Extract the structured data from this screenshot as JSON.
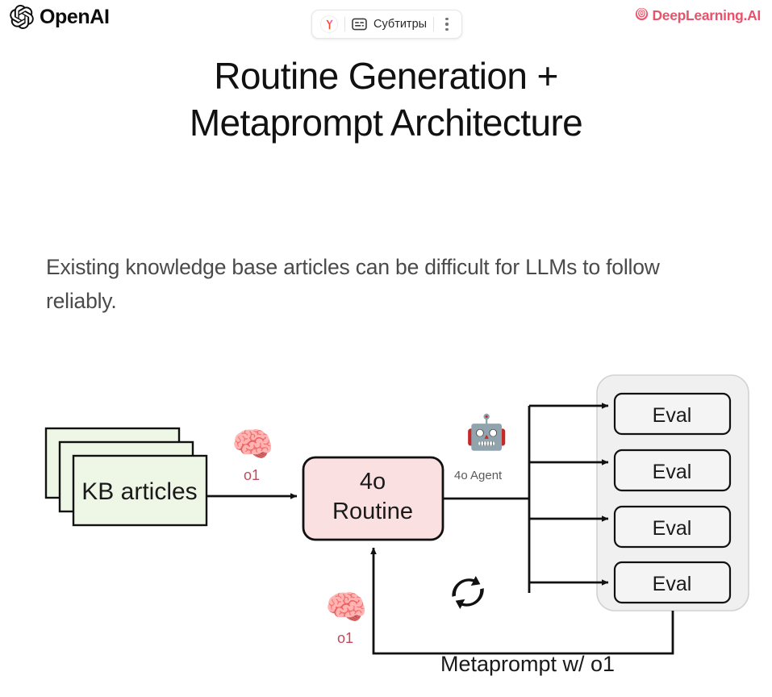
{
  "branding": {
    "openai_name": "OpenAI",
    "openai_icon": "openai-logo-icon",
    "deeplearning_name": "DeepLearning.AI",
    "deeplearning_icon": "deeplearning-ai-logo-icon",
    "deeplearning_color": "#e8526b"
  },
  "toolbar": {
    "yandex_icon": "yandex-badge-icon",
    "subtitles_icon": "subtitles-cc-icon",
    "subtitles_label": "Субтитры",
    "more_icon": "kebab-menu-icon"
  },
  "slide": {
    "title_line1": "Routine Generation +",
    "title_line2": "Metaprompt Architecture",
    "body_text": "Existing knowledge base articles can be difficult for LLMs to follow reliably."
  },
  "diagram": {
    "kb_node_label": "KB articles",
    "kb_node_color": "#eef6e6",
    "routine_node_label_line1": "4o",
    "routine_node_label_line2": "Routine",
    "routine_node_color": "#fbe0e2",
    "brain_icon": "🧠",
    "brain_top_tag": "o1",
    "brain_bottom_tag": "o1",
    "agent_icon": "🤖",
    "agent_label": "4o Agent",
    "loop_icon": "refresh-loop-icon",
    "eval_container_color": "#f0f0f0",
    "eval_box_color": "#f4f4f4",
    "eval_labels": [
      "Eval",
      "Eval",
      "Eval",
      "Eval"
    ],
    "feedback_label": "Metaprompt w/ o1"
  }
}
